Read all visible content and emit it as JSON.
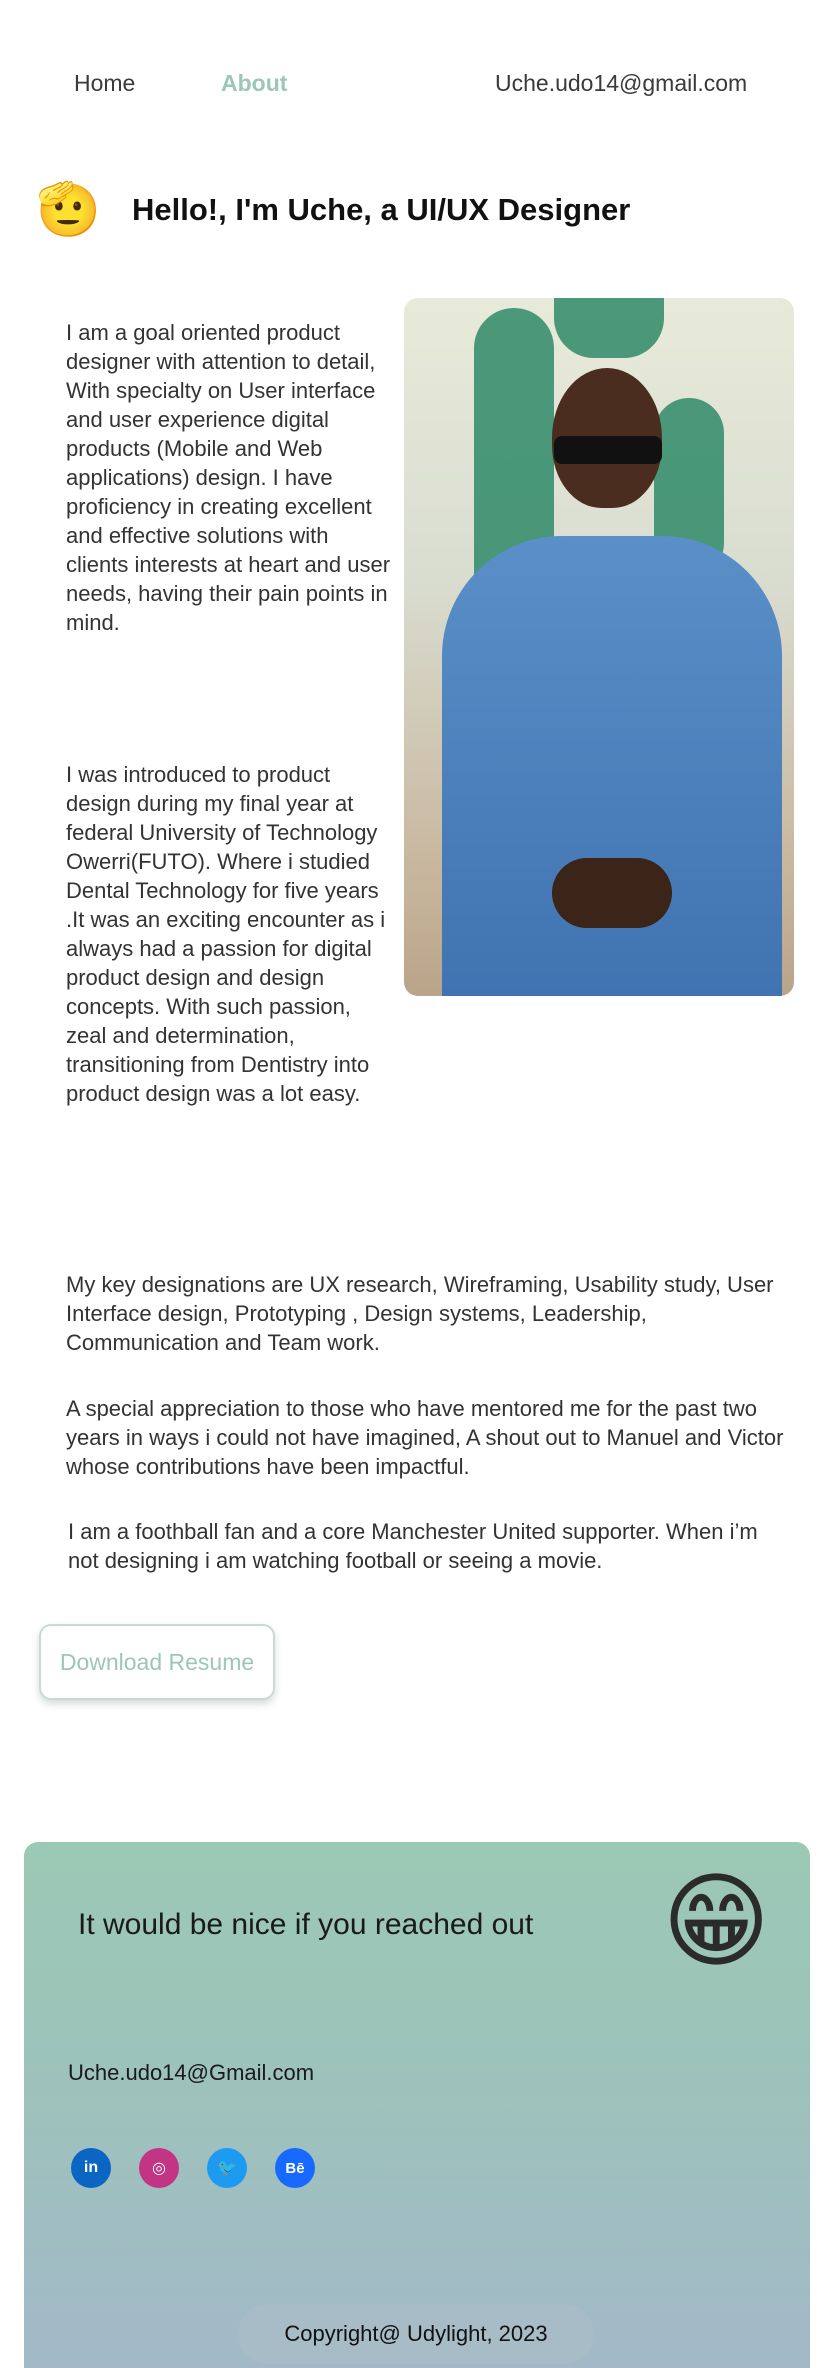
{
  "nav": {
    "home": "Home",
    "about": "About",
    "email": "Uche.udo14@gmail.com"
  },
  "hero": {
    "emoji": "🫡",
    "title": "Hello!, I'm Uche, a UI/UX Designer"
  },
  "intro": {
    "p1": "I am a goal oriented product designer with attention to detail, With specialty on User interface and user experience digital products (Mobile and Web applications) design. I have proficiency in creating excellent and effective solutions with clients interests at heart and user needs, having their pain points in mind.",
    "p2": "I was introduced to product design during my final year at federal University of Technology Owerri(FUTO). Where i studied Dental Technology for five years .It was an exciting encounter as i always had a passion for digital product design and design concepts. With such passion, zeal and determination, transitioning from Dentistry into product design was a lot easy."
  },
  "details": {
    "d1": "My key designations are UX research, Wireframing, Usability study, User Interface design, Prototyping , Design systems, Leadership, Communication and Team work.",
    "d2": "A special appreciation to those who have mentored me for the past two years in ways i could not have imagined, A shout out to Manuel and Victor whose contributions have been impactful.",
    "d3": "I am a foothball fan and a core Manchester United supporter. When i’m not designing i am watching football or seeing a movie."
  },
  "resume": {
    "label": "Download Resume"
  },
  "contact": {
    "cta": "It would be nice if you reached out",
    "emoji": "😁",
    "email": "Uche.udo14@Gmail.com",
    "socials": {
      "linkedin": "in",
      "instagram": "◎",
      "twitter": "🐦",
      "behance": "Bē"
    },
    "copyright": "Copyright@ Udylight, 2023"
  },
  "colors": {
    "accent": "#9cc6b9",
    "contact_bg_top": "#9cc8b6",
    "contact_bg_bottom": "#a3b8c8"
  }
}
